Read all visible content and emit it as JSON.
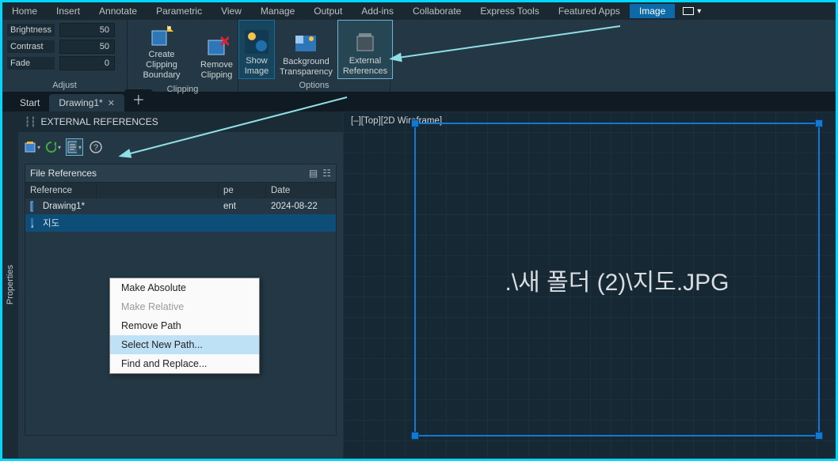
{
  "ribbonTabs": [
    "Home",
    "Insert",
    "Annotate",
    "Parametric",
    "View",
    "Manage",
    "Output",
    "Add-ins",
    "Collaborate",
    "Express Tools",
    "Featured Apps",
    "Image"
  ],
  "activeRibbonTab": "Image",
  "adjust": {
    "brightnessLabel": "Brightness",
    "brightnessValue": "50",
    "contrastLabel": "Contrast",
    "contrastValue": "50",
    "fadeLabel": "Fade",
    "fadeValue": "0",
    "panelLabel": "Adjust"
  },
  "clipping": {
    "createLabel1": "Create Clipping",
    "createLabel2": "Boundary",
    "removeLabel1": "Remove",
    "removeLabel2": "Clipping",
    "panelLabel": "Clipping"
  },
  "options": {
    "showLabel1": "Show",
    "showLabel2": "Image",
    "bgLabel1": "Background",
    "bgLabel2": "Transparency",
    "extLabel1": "External",
    "extLabel2": "References",
    "panelLabel": "Options"
  },
  "docTabs": {
    "start": "Start",
    "drawing": "Drawing1*"
  },
  "palette": {
    "title": "EXTERNAL REFERENCES",
    "filerefsTitle": "File References",
    "cols": {
      "reference": "Reference",
      "type": "pe",
      "date": "Date"
    },
    "rows": [
      {
        "name": "Drawing1*",
        "type": "ent",
        "date": "2024-08-22",
        "icon": "dwg"
      },
      {
        "name": "지도",
        "icon": "img",
        "selected": true
      }
    ]
  },
  "contextMenu": {
    "makeAbsolute": "Make Absolute",
    "makeRelative": "Make Relative",
    "removePath": "Remove Path",
    "selectNew": "Select New Path...",
    "findReplace": "Find and Replace..."
  },
  "viewport": {
    "cornerLabel": "[–][Top][2D Wireframe]",
    "pathText": ".\\새 폴더 (2)\\지도.JPG"
  },
  "sideRailLabel": "Properties"
}
